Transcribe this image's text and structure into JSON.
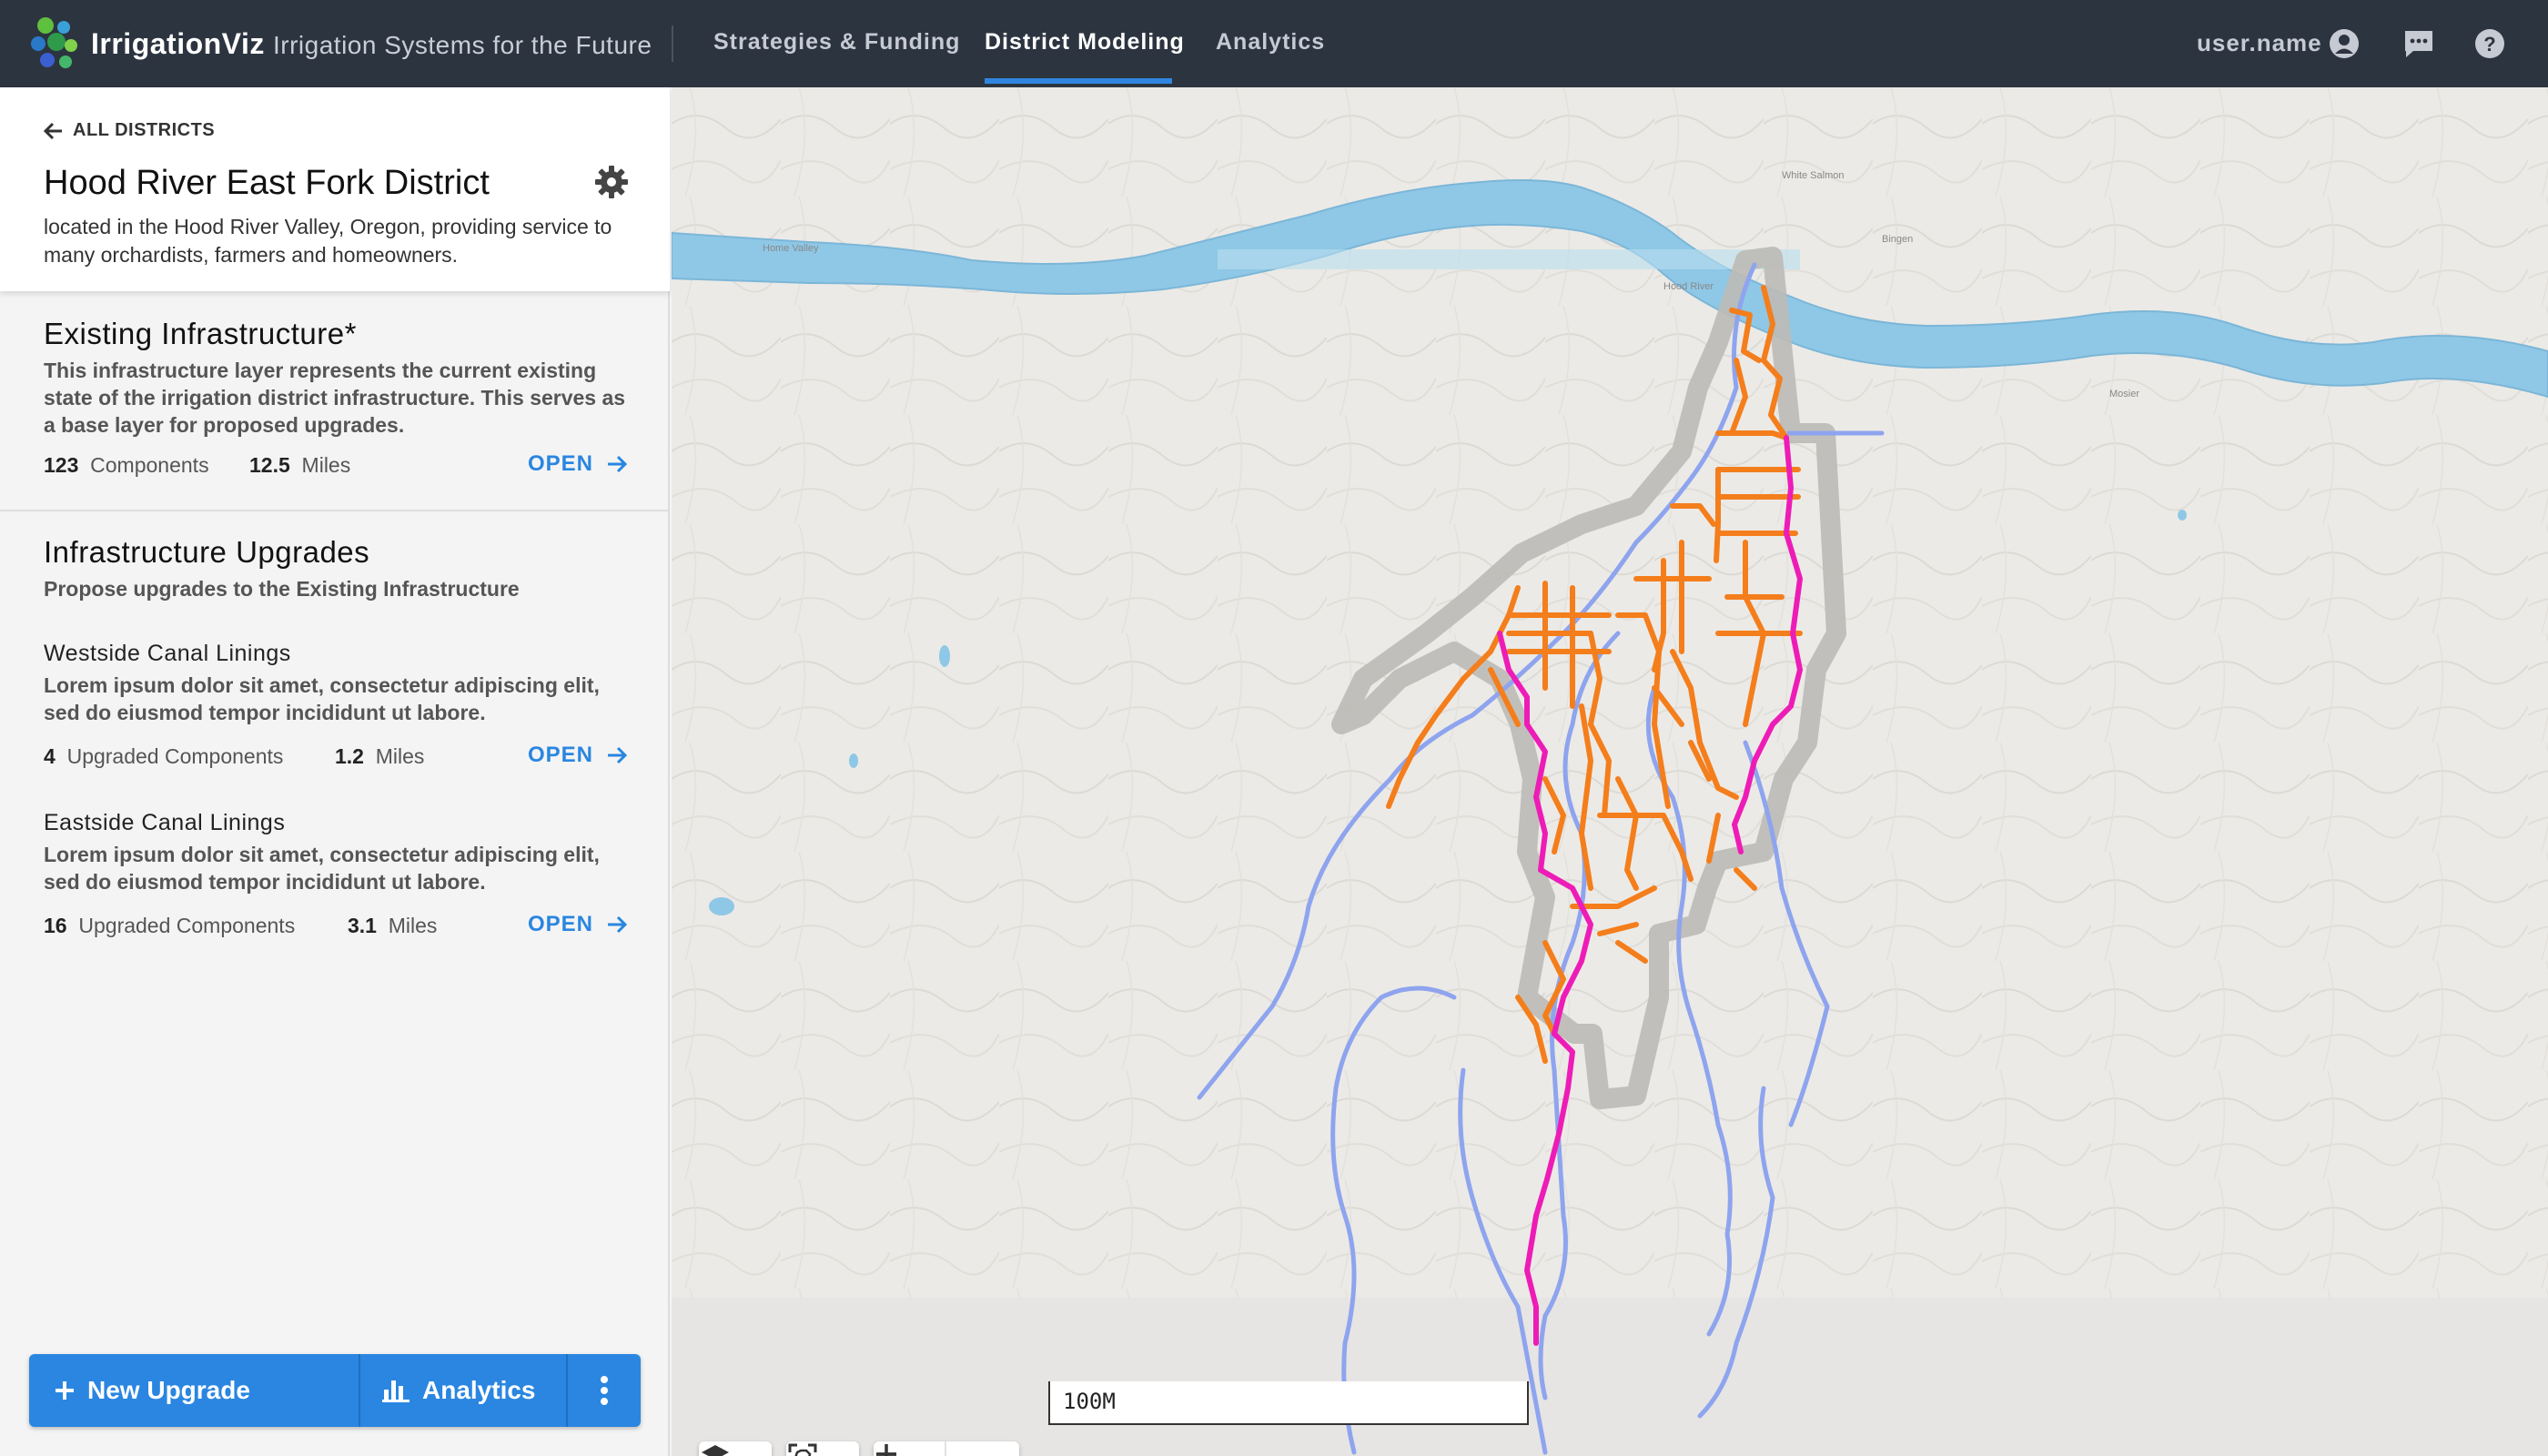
{
  "app": {
    "brand": "IrrigationViz",
    "tagline": "Irrigation Systems for the Future"
  },
  "nav": {
    "items": [
      {
        "label": "Strategies & Funding"
      },
      {
        "label": "District Modeling",
        "active": true
      },
      {
        "label": "Analytics"
      }
    ]
  },
  "user": {
    "name": "user.name",
    "icons": [
      "user-icon",
      "chat-icon",
      "help-icon"
    ]
  },
  "district": {
    "back_label": "ALL DISTRICTS",
    "title": "Hood River East Fork District",
    "description": "located in the Hood River Valley, Oregon, providing service to many orchardists, farmers and homeowners."
  },
  "existing": {
    "title": "Existing Infrastructure*",
    "description": "This infrastructure layer represents the current existing state of the irrigation district infrastructure. This serves as a base layer for proposed upgrades.",
    "components_value": "123",
    "components_label": "Components",
    "miles_value": "12.5",
    "miles_label": "Miles",
    "open_label": "OPEN"
  },
  "upgrades": {
    "title": "Infrastructure Upgrades",
    "description": "Propose upgrades to the Existing Infrastructure",
    "items": [
      {
        "title": "Westside Canal Linings",
        "description": "Lorem ipsum dolor sit amet, consectetur adipiscing elit, sed do eiusmod tempor incididunt ut labore.",
        "components_value": "4",
        "components_label": "Upgraded Components",
        "miles_value": "1.2",
        "miles_label": "Miles",
        "open_label": "OPEN"
      },
      {
        "title": "Eastside Canal Linings",
        "description": "Lorem ipsum dolor sit amet, consectetur adipiscing elit, sed do eiusmod tempor incididunt ut labore.",
        "components_value": "16",
        "components_label": "Upgraded Components",
        "miles_value": "3.1",
        "miles_label": "Miles",
        "open_label": "OPEN"
      }
    ]
  },
  "actions": {
    "new_upgrade_label": "New Upgrade",
    "analytics_label": "Analytics"
  },
  "map": {
    "scale_label": "100M",
    "places": [
      "White Salmon",
      "Bingen",
      "Hood River",
      "Mosier",
      "Home Valley"
    ],
    "colors": {
      "river": "#8fc8e6",
      "district_boundary": "#b9b7b3",
      "streams": "#8ea4ee",
      "existing_canals": "#f47e1c",
      "upgrade_canals": "#ee1cb7"
    }
  }
}
